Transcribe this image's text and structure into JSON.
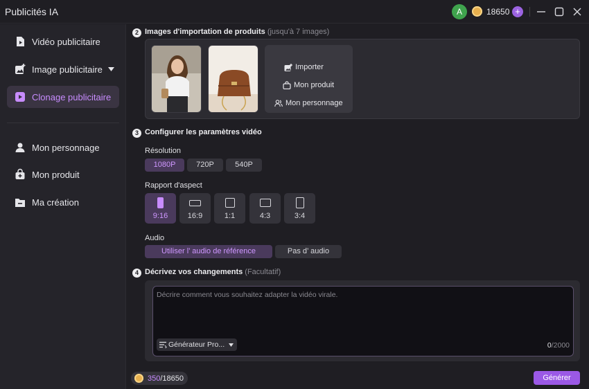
{
  "app": {
    "title": "Publicités IA",
    "avatar_initial": "A",
    "credits": "18650"
  },
  "sidebar": {
    "items": [
      {
        "label": "Vidéo publicitaire",
        "icon": "video-icon"
      },
      {
        "label": "Image publicitaire",
        "icon": "image-add-icon"
      },
      {
        "label": "Clonage publicitaire",
        "icon": "clone-icon",
        "active": true
      },
      {
        "label": "Mon personnage",
        "icon": "person-icon"
      },
      {
        "label": "Mon produit",
        "icon": "product-icon"
      },
      {
        "label": "Ma création",
        "icon": "folder-icon"
      }
    ]
  },
  "steps": {
    "import": {
      "number": "2",
      "title": "Images d'importation de produits",
      "hint": "(jusqu'à 7 images)"
    },
    "config": {
      "number": "3",
      "title": "Configurer les paramètres vidéo"
    },
    "describe": {
      "number": "4",
      "title": "Décrivez vos changements",
      "hint": "(Facultatif)"
    }
  },
  "import_actions": {
    "upload": "Importer",
    "my_product": "Mon produit",
    "my_character": "Mon personnage"
  },
  "resolution": {
    "label": "Résolution",
    "options": [
      "1080P",
      "720P",
      "540P"
    ],
    "selected": "1080P"
  },
  "aspect": {
    "label": "Rapport d'aspect",
    "options": [
      "9:16",
      "16:9",
      "1:1",
      "4:3",
      "3:4"
    ],
    "selected": "9:16"
  },
  "audio": {
    "label": "Audio",
    "options": [
      "Utiliser l’ audio de référence",
      "Pas d’ audio"
    ],
    "selected": "Utiliser l’ audio de référence"
  },
  "description": {
    "placeholder": "Décrire comment vous souhaitez adapter la vidéo virale.",
    "generator_label": "Générateur Pro...",
    "count": "0",
    "max": "/2000"
  },
  "footer": {
    "cost": "350",
    "total": "/18650",
    "generate_label": "Générer"
  },
  "colors": {
    "accent": "#9b59e6",
    "accent_text": "#c88cff"
  }
}
